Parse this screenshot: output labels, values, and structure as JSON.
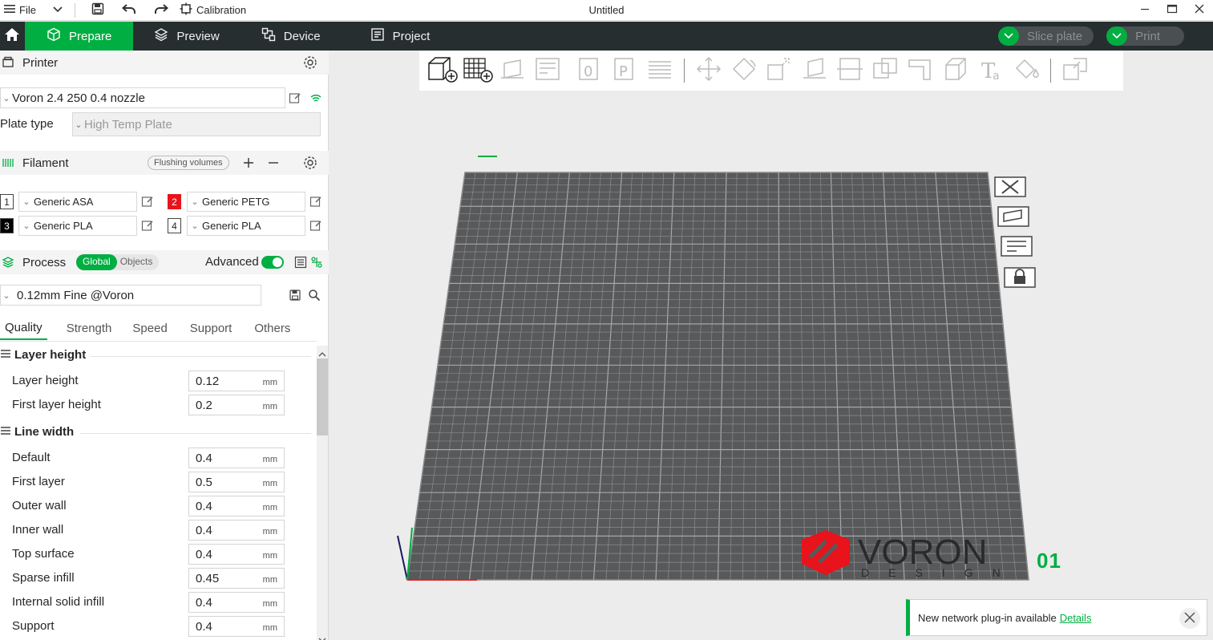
{
  "titlebar": {
    "file_label": "File",
    "calibration_label": "Calibration",
    "window_title": "Untitled"
  },
  "nav": {
    "tabs": [
      {
        "label": "Prepare",
        "icon": "cube-icon",
        "active": true
      },
      {
        "label": "Preview",
        "icon": "layers-icon",
        "active": false
      },
      {
        "label": "Device",
        "icon": "device-icon",
        "active": false
      },
      {
        "label": "Project",
        "icon": "project-icon",
        "active": false
      }
    ],
    "slice_label": "Slice plate",
    "print_label": "Print"
  },
  "printer": {
    "section_title": "Printer",
    "printer_name": "Voron 2.4 250 0.4 nozzle",
    "plate_type_label": "Plate type",
    "plate_type_value": "High Temp Plate"
  },
  "filament": {
    "section_title": "Filament",
    "flushing_label": "Flushing volumes",
    "slots": [
      {
        "num": "1",
        "name": "Generic ASA",
        "color": "#ffffff",
        "text_color": "#262626"
      },
      {
        "num": "2",
        "name": "Generic PETG",
        "color": "#e8131b",
        "text_color": "#ffffff"
      },
      {
        "num": "3",
        "name": "Generic PLA",
        "color": "#000000",
        "text_color": "#ffffff"
      },
      {
        "num": "4",
        "name": "Generic PLA",
        "color": "#ffffff",
        "text_color": "#262626"
      }
    ]
  },
  "process": {
    "section_title": "Process",
    "toggle_global": "Global",
    "toggle_objects": "Objects",
    "advanced_label": "Advanced",
    "preset_name": "0.12mm Fine @Voron",
    "tabs": [
      "Quality",
      "Strength",
      "Speed",
      "Support",
      "Others"
    ],
    "groups": [
      {
        "title": "Layer height",
        "options": [
          {
            "label": "Layer height",
            "value": "0.12",
            "unit": "mm"
          },
          {
            "label": "First layer height",
            "value": "0.2",
            "unit": "mm"
          }
        ]
      },
      {
        "title": "Line width",
        "options": [
          {
            "label": "Default",
            "value": "0.4",
            "unit": "mm"
          },
          {
            "label": "First layer",
            "value": "0.5",
            "unit": "mm"
          },
          {
            "label": "Outer wall",
            "value": "0.4",
            "unit": "mm"
          },
          {
            "label": "Inner wall",
            "value": "0.4",
            "unit": "mm"
          },
          {
            "label": "Top surface",
            "value": "0.4",
            "unit": "mm"
          },
          {
            "label": "Sparse infill",
            "value": "0.45",
            "unit": "mm"
          },
          {
            "label": "Internal solid infill",
            "value": "0.4",
            "unit": "mm"
          },
          {
            "label": "Support",
            "value": "0.4",
            "unit": "mm"
          }
        ]
      }
    ]
  },
  "canvas": {
    "plate_number": "01",
    "logo_text": "VORON",
    "logo_subtext": "DESIGN"
  },
  "notification": {
    "text": "New network plug-in available",
    "link": "Details"
  },
  "colors": {
    "accent": "#00ae42",
    "nav_bg": "#262e30",
    "plate": "#58595b",
    "logo_red": "#e8131b"
  }
}
